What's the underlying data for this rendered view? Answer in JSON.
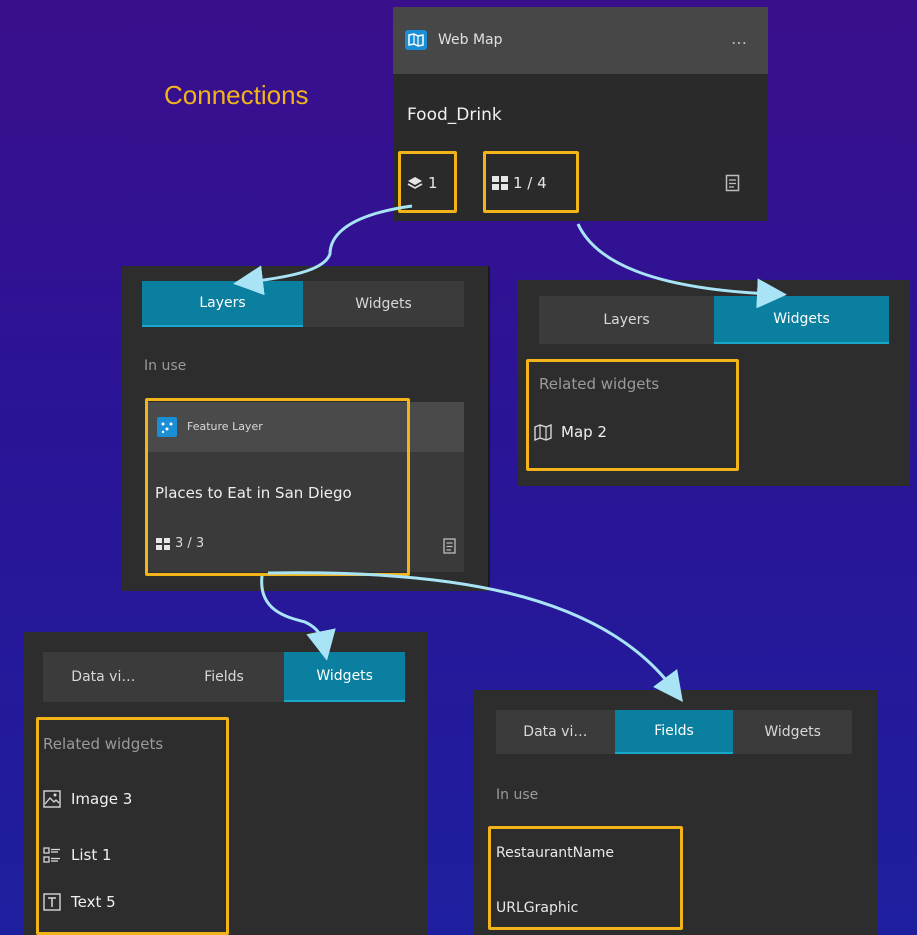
{
  "title": "Connections",
  "webmap": {
    "type_label": "Web Map",
    "menu": "…",
    "name": "Food_Drink",
    "layers_count": "1",
    "widgets_count": "1 / 4"
  },
  "layers_panel": {
    "tabs": [
      "Layers",
      "Widgets"
    ],
    "section": "In use",
    "card": {
      "type_label": "Feature Layer",
      "name": "Places to Eat in San Diego",
      "widgets_count": "3 / 3"
    }
  },
  "widgets_panel": {
    "tabs": [
      "Layers",
      "Widgets"
    ],
    "section": "Related widgets",
    "item": "Map 2"
  },
  "layer_widgets_panel": {
    "tabs": [
      "Data vi…",
      "Fields",
      "Widgets"
    ],
    "section": "Related widgets",
    "items": [
      "Image 3",
      "List 1",
      "Text 5"
    ]
  },
  "layer_fields_panel": {
    "tabs": [
      "Data vi…",
      "Fields",
      "Widgets"
    ],
    "section": "In use",
    "items": [
      "RestaurantName",
      "URLGraphic"
    ]
  },
  "colors": {
    "highlight": "#f2b418",
    "accent": "#0a7fa0",
    "arrow": "#a8e4f5",
    "title": "#f2b418"
  }
}
